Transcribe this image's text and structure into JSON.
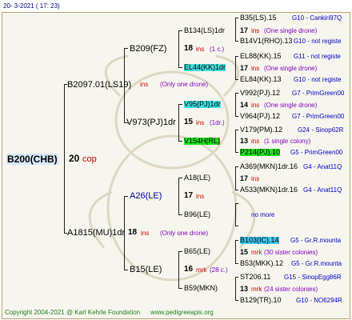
{
  "header": {
    "date": "20-  3-2021  ( 17: 23)"
  },
  "root": {
    "name": "B200(CHB)",
    "ins_num": "20",
    "ins_label": "cop"
  },
  "gen1": [
    {
      "name": "B2097.01(LS19)",
      "ins_num": "19",
      "ins_label": "ins",
      "note": "(Only one drone)"
    },
    {
      "name": "A1815(MU)1dr",
      "ins_num": "18",
      "ins_label": "ins",
      "note": "(Only one drone)"
    }
  ],
  "gen2": [
    {
      "name": "B209(FZ)",
      "ins_num": "18",
      "ins_label": "ins",
      "note": "(1 c.)"
    },
    {
      "name": "V973(PJ)1dr",
      "ins_num": "15",
      "ins_label": "ins",
      "note": "(1dr.)"
    },
    {
      "name": "A26(LE)",
      "ins_num": "17",
      "ins_label": "ins",
      "note": ""
    },
    {
      "name": "B15(LE)",
      "ins_num": "16",
      "ins_label": "mrk",
      "note": "(28 c.)"
    }
  ],
  "gen3": [
    {
      "name": "B134(LS)1dr",
      "ins_num": "17",
      "ins_label": "ins",
      "note": "(One single drone)"
    },
    {
      "name": "EL44(KK)1dr",
      "ins_num": "17",
      "ins_label": "ins",
      "note": "(One single drone)"
    },
    {
      "name": "V95(PJ)1dr",
      "ins_num": "14",
      "ins_label": "ins",
      "note": "(One single drone)"
    },
    {
      "name": "V154H(RL)",
      "ins_num": "13",
      "ins_label": "ins",
      "note": "(1 single colony)"
    },
    {
      "name": "A18(LE)",
      "ins_num": "17",
      "ins_label": "ins",
      "note": ""
    },
    {
      "name": "B96(LE)",
      "ins_num": "",
      "ins_label": "",
      "note": ""
    },
    {
      "name": "B65(LE)",
      "ins_num": "15",
      "ins_label": "mrk",
      "note": "(30 sister colonies)"
    },
    {
      "name": "B59(MKN)",
      "ins_num": "13",
      "ins_label": "mrk",
      "note": "(24 sister colonies)"
    }
  ],
  "gen4": [
    {
      "name": "B35(LS).15",
      "link": "G10 - Cankiri97Q"
    },
    {
      "name": "B14V1(RHO).13",
      "link": "G10 - not registe"
    },
    {
      "name": "EL88(KK).15",
      "link": "G11 - not registe"
    },
    {
      "name": "EL84(KK).13",
      "link": "G10 - not registe"
    },
    {
      "name": "V992(PJ).12",
      "link": "G7 - PrimGreen00"
    },
    {
      "name": "V964(PJ).12",
      "link": "G7 - PrimGreen00"
    },
    {
      "name": "V179(PM).12",
      "link": "G24 - Sinop62R"
    },
    {
      "name": "P214(PJ).10",
      "link": "G5 - PrimGreen00"
    },
    {
      "name": "A369(MKN)1dr.16",
      "link": "G4 - Anat11Q"
    },
    {
      "name": "A533(MKN)1dr.16",
      "link": "G4 - Anat11Q"
    },
    {
      "name": "B103(IC).14",
      "link": "G5 - Gr.R.mounta"
    },
    {
      "name": "B53(MKK).12",
      "link": "G5 - Gr.R.mounta"
    },
    {
      "name": "ST206.11",
      "link": "G15 - SinopEgg86R"
    },
    {
      "name": "B129(TR).10",
      "link": "G10 - NO6294R"
    }
  ],
  "no_more": "no more",
  "footer": {
    "copyright": "Copyright 2004-2021 @ Karl Kehrle Foundation",
    "url": "www.pedigreeapis.org"
  },
  "colors": {
    "cyan": "#40e0e0",
    "green": "#20e020",
    "light_blue": "#40c8f0",
    "ins_red": "#cc0000",
    "note_purple": "#8000c0",
    "link_blue": "#0000cc"
  }
}
